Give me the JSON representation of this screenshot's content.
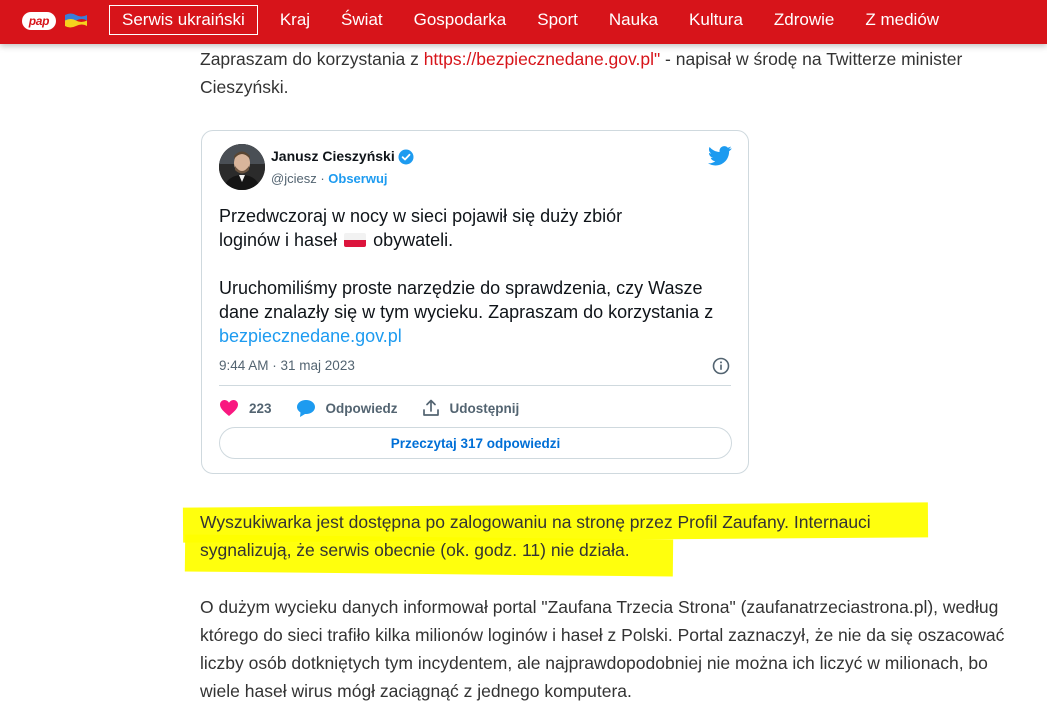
{
  "header": {
    "logo_text": "pap",
    "flag_icon": "ukraine-flag-icon",
    "nav": [
      {
        "label": "Serwis ukraiński",
        "active": true
      },
      {
        "label": "Kraj"
      },
      {
        "label": "Świat"
      },
      {
        "label": "Gospodarka"
      },
      {
        "label": "Sport"
      },
      {
        "label": "Nauka"
      },
      {
        "label": "Kultura"
      },
      {
        "label": "Zdrowie"
      },
      {
        "label": "Z mediów"
      }
    ]
  },
  "article": {
    "p1_before": "Zapraszam do korzystania z ",
    "p1_link": "https://bezpiecznedane.gov.pl\"",
    "p1_after": " - napisał w środę na Twitterze minister Cieszyński.",
    "p2": "Wyszukiwarka jest dostępna po zalogowaniu na stronę przez Profil Zaufany. Internauci sygnalizują, że serwis obecnie (ok. godz. 11) nie działa.",
    "p3": "O dużym wycieku danych informował portal \"Zaufana Trzecia Strona\" (zaufanatrzeciastrona.pl), według którego do sieci trafiło kilka milionów loginów i haseł z Polski. Portal zaznaczył, że nie da się oszacować liczby osób dotkniętych tym incydentem, ale najprawdopodobniej nie można ich liczyć w milionach, bo wiele haseł wirus mógł zaciągnąć z jednego komputera."
  },
  "tweet": {
    "author": "Janusz Cieszyński",
    "handle": "@jciesz",
    "separator": " · ",
    "follow": "Obserwuj",
    "body_line1": "Przedwczoraj w nocy w sieci pojawił się duży zbiór",
    "body_line2_a": "loginów i haseł ",
    "body_line2_b": " obywateli.",
    "body_para2": "Uruchomiliśmy proste narzędzie do sprawdzenia, czy Wasze dane znalazły się w tym wycieku. Zapraszam do korzystania z ",
    "body_link": "bezpiecznedane.gov.pl",
    "timestamp": "9:44 AM · 31 maj 2023",
    "likes": "223",
    "reply_label": "Odpowiedz",
    "share_label": "Udostępnij",
    "read_replies": "Przeczytaj 317 odpowiedzi"
  },
  "colors": {
    "brand_red": "#d7141a",
    "twitter_blue": "#1d9bf0",
    "highlight": "#ffff00"
  }
}
